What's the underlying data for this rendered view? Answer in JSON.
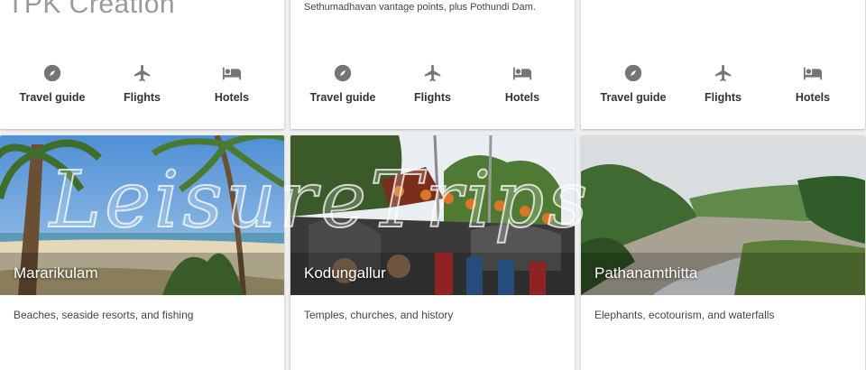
{
  "brand": "TPK Creation",
  "watermark": "LeisureTrips",
  "top_cards": [
    {
      "subtitle": "",
      "actions": [
        "Travel guide",
        "Flights",
        "Hotels"
      ]
    },
    {
      "subtitle": "Sethumadhavan vantage points, plus Pothundi Dam.",
      "actions": [
        "Travel guide",
        "Flights",
        "Hotels"
      ]
    },
    {
      "subtitle": "",
      "actions": [
        "Travel guide",
        "Flights",
        "Hotels"
      ]
    }
  ],
  "destinations": [
    {
      "name": "Mararikulam",
      "description": "Beaches, seaside resorts, and fishing"
    },
    {
      "name": "Kodungallur",
      "description": "Temples, churches, and history"
    },
    {
      "name": "Pathanamthitta",
      "description": "Elephants, ecotourism, and waterfalls"
    }
  ],
  "icons": [
    "compass-icon",
    "plane-icon",
    "bed-icon"
  ]
}
